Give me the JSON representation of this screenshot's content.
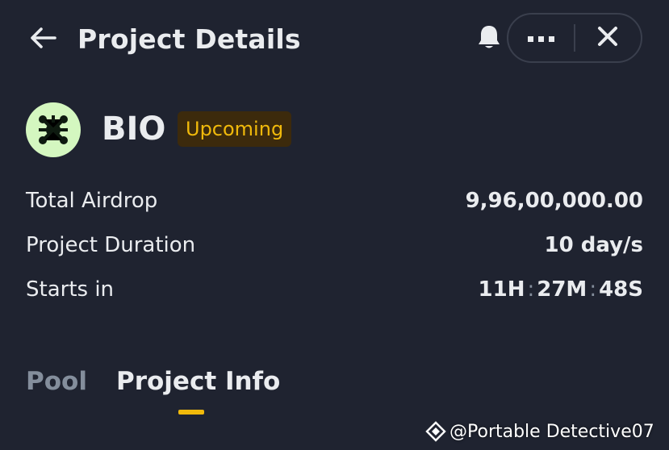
{
  "header": {
    "title": "Project Details",
    "back_icon": "arrow-left-icon",
    "bell_icon": "bell-icon",
    "more_icon": "more-horizontal-icon",
    "close_icon": "close-icon"
  },
  "token": {
    "name": "BIO",
    "status": "Upcoming",
    "logo_icon": "bio-token-logo"
  },
  "info": {
    "total_airdrop_label": "Total Airdrop",
    "total_airdrop_value": "9,96,00,000.00",
    "duration_label": "Project Duration",
    "duration_value": "10 day/s",
    "starts_in_label": "Starts in",
    "countdown": {
      "hours": "11H",
      "minutes": "27M",
      "seconds": "48S",
      "separator": ":"
    }
  },
  "tabs": [
    {
      "label": "Pool",
      "active": false
    },
    {
      "label": "Project Info",
      "active": true
    }
  ],
  "watermark": {
    "text": "@Portable Detective07",
    "icon": "binance-square-icon"
  },
  "colors": {
    "background": "#1f2330",
    "accent": "#f0b90b",
    "text_primary": "#eaecef",
    "text_secondary": "#848e9c",
    "badge_bg": "#3c2a0c",
    "logo_bg": "#d4f7c0"
  }
}
